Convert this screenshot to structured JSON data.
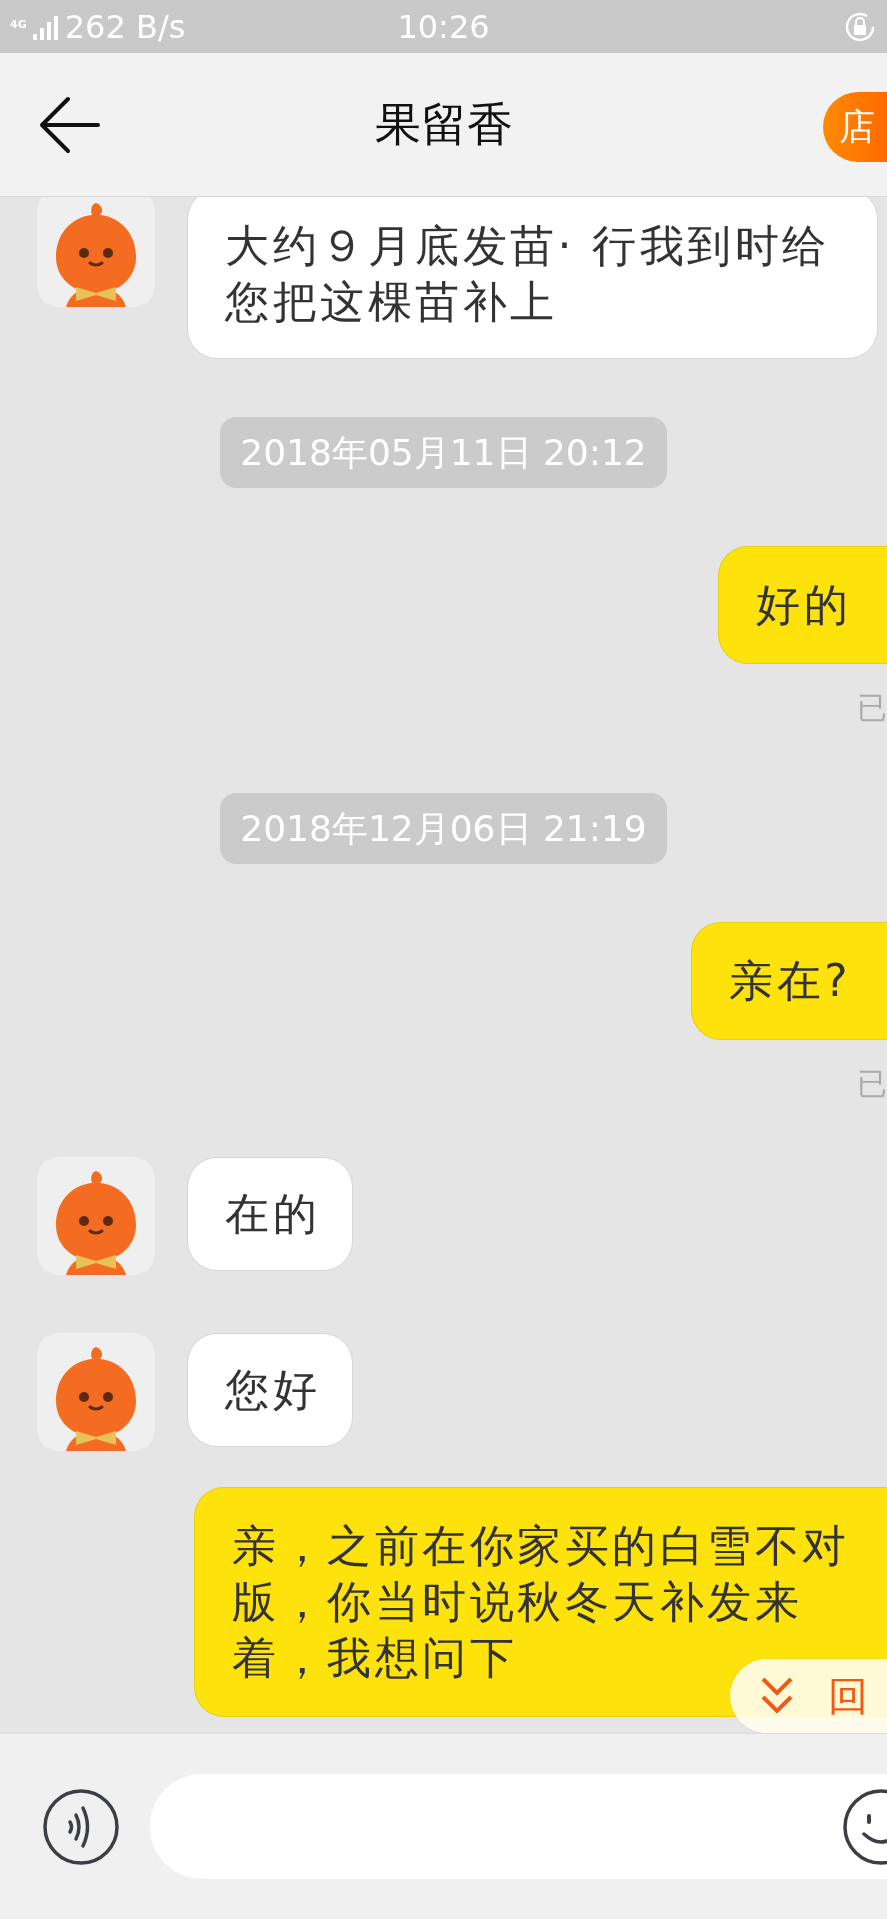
{
  "status_bar": {
    "network": "4G",
    "speed": "262 B/s",
    "time": "10:26"
  },
  "header": {
    "title": "果留香",
    "shop_button": "店"
  },
  "messages": [
    {
      "kind": "received",
      "text": "大约９月底发苗· 行我到时给您把这棵苗补上"
    },
    {
      "kind": "timestamp",
      "text": "2018年05月11日 20:12"
    },
    {
      "kind": "sent",
      "text": "好的",
      "receipt": "已"
    },
    {
      "kind": "timestamp",
      "text": "2018年12月06日 21:19"
    },
    {
      "kind": "sent",
      "text": "亲在?",
      "receipt": "已"
    },
    {
      "kind": "received",
      "text": "在的"
    },
    {
      "kind": "received",
      "text": "您好"
    },
    {
      "kind": "sent",
      "text": "亲，之前在你家买的白雪不对版，你当时说秋冬天补发来着，我想问下"
    }
  ],
  "jump_button": {
    "label": "回"
  }
}
